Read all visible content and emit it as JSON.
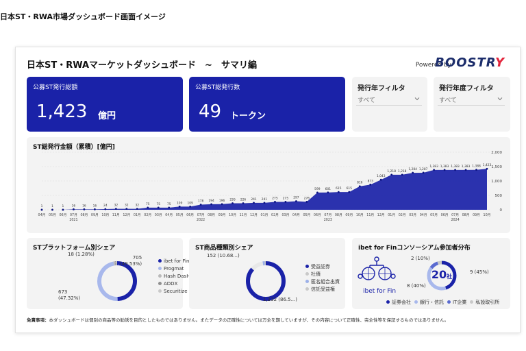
{
  "caption": "日本ST・RWA市場ダッシュボード画面イメージ",
  "header": {
    "title": "日本ST・RWAマーケットダッシュボード　~　サマリ編",
    "powered_by": "Powered by",
    "brand": "BOOSTR",
    "brand_tail": "Y"
  },
  "kpis": {
    "issuance_amount": {
      "label": "公募ST発行総額",
      "value": "1,423",
      "unit": "億円"
    },
    "issuance_count": {
      "label": "公募ST総発行数",
      "value": "49",
      "unit": "トークン"
    }
  },
  "filters": {
    "issue_year": {
      "label": "発行年フィルタ",
      "value": "すべて"
    },
    "fiscal_year": {
      "label": "発行年度フィルタ",
      "value": "すべて"
    }
  },
  "cumulative_card": {
    "title": "ST総発行金額（累積）[億円]"
  },
  "platform_card": {
    "title": "STプラットフォーム別シェア",
    "slices": [
      {
        "name": "ibet for Fin",
        "value": 705,
        "label": "705",
        "pct": "(49.53%)",
        "color": "#1a22a8"
      },
      {
        "name": "Progmat",
        "value": 673,
        "label": "673",
        "pct": "(47.32%)",
        "color": "#a8b8ec"
      },
      {
        "name": "Hash DasH",
        "value": 18,
        "label": "18 (1.28%)",
        "pct": "",
        "color": "#b9b9b9"
      },
      {
        "name": "ADDX",
        "value": 14,
        "label": "",
        "pct": "",
        "color": "#909090"
      },
      {
        "name": "Securitize",
        "value": 13,
        "label": "",
        "pct": "",
        "color": "#c9c9c9"
      }
    ]
  },
  "product_card": {
    "title": "ST商品種類別シェア",
    "label_top": "152 (10.68...)",
    "label_bottom": "1,232 (86.5...)",
    "slices": [
      {
        "name": "受益証券",
        "value": 1232,
        "color": "#1a22a8"
      },
      {
        "name": "社債",
        "value": 152,
        "color": "#e8e8e8"
      },
      {
        "name": "匿名組合出資",
        "value": 24,
        "color": "#9cb0e8"
      },
      {
        "name": "信託受益権",
        "value": 15,
        "color": "#c9c9c9"
      }
    ]
  },
  "consortium_card": {
    "title": "ibet for Finコンソーシアム参加者分布",
    "logo_text": "ibet for Fin",
    "center_value": "20",
    "center_unit": "社",
    "label_a": "2 (10%)",
    "label_b": "9 (45%)",
    "label_c": "8 (40%)",
    "slices": [
      {
        "name": "証券会社",
        "value": 9,
        "color": "#1a22a8"
      },
      {
        "name": "銀行・信託",
        "value": 8,
        "color": "#a8b8ec"
      },
      {
        "name": "IT企業",
        "value": 2,
        "color": "#5a6ad0"
      },
      {
        "name": "私設取引所",
        "value": 1,
        "color": "#c9c9c9"
      }
    ]
  },
  "disclaimer": {
    "label": "免責事項：",
    "text": "本ダッシュボードは個別の商品等の勧誘を目的としたものではありません。またデータの正確性については万全を期していますが、その内容について正確性、完全性等を保証するものではありません。"
  },
  "chart_data": {
    "type": "area",
    "title": "ST総発行金額（累積）[億円]",
    "color": "#1a22a8",
    "yticks": [
      "2,000",
      "1,500",
      "1,000",
      "500",
      "0"
    ],
    "ylim": [
      0,
      2000
    ],
    "x": [
      "04月",
      "05月",
      "06月",
      "07月",
      "08月",
      "09月",
      "10月",
      "11月",
      "12月",
      "01月",
      "02月",
      "03月",
      "04月",
      "05月",
      "06月",
      "07月",
      "08月",
      "09月",
      "10月",
      "11月",
      "12月",
      "01月",
      "02月",
      "03月",
      "04月",
      "05月",
      "06月",
      "07月",
      "08月",
      "09月",
      "10月",
      "11月",
      "12月",
      "01月",
      "02月",
      "03月",
      "04月",
      "05月",
      "06月",
      "07月",
      "08月",
      "09月",
      "10月"
    ],
    "years": [
      {
        "label": "2021",
        "index": 3
      },
      {
        "label": "2022",
        "index": 15
      },
      {
        "label": "2023",
        "index": 27
      },
      {
        "label": "2024",
        "index": 39
      }
    ],
    "values": [
      1,
      1,
      1,
      16,
      16,
      16,
      24,
      32,
      32,
      32,
      75,
      75,
      75,
      109,
      109,
      178,
      194,
      196,
      226,
      226,
      241,
      241,
      275,
      275,
      297,
      276,
      599,
      601,
      615,
      615,
      816,
      873,
      1043,
      1218,
      1218,
      1284,
      1287,
      1383,
      1383,
      1383,
      1383,
      1388,
      1423
    ],
    "labels": [
      "1",
      "1",
      "1",
      "16",
      "16",
      "16",
      "24",
      "32",
      "32",
      "32",
      "75",
      "75",
      "75",
      "109",
      "109",
      "178",
      "194",
      "196",
      "226",
      "226",
      "241",
      "241",
      "275",
      "275",
      "297",
      "276",
      "599",
      "601",
      "615",
      "615",
      "816",
      "873",
      "1,043",
      "1,218",
      "1,218",
      "1,284",
      "1,287",
      "1,383",
      "1,383",
      "1,383",
      "1,383",
      "1,388",
      "1,423"
    ]
  }
}
